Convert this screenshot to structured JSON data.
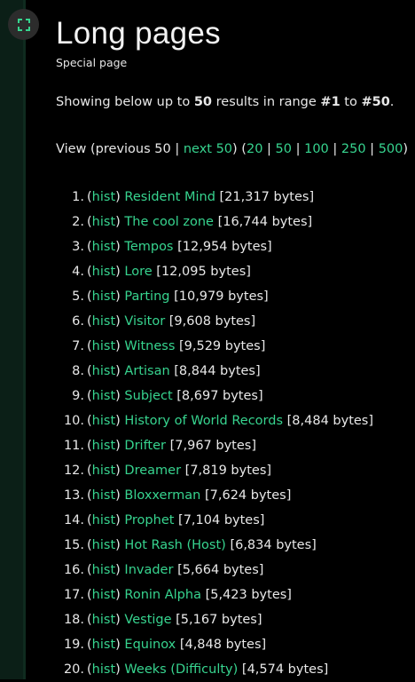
{
  "page": {
    "title": "Long pages",
    "subtitle": "Special page",
    "info": {
      "prefix": "Showing below up to ",
      "limit": "50",
      "middle": " results in range ",
      "from": "#1",
      "to_word": " to ",
      "to": "#50",
      "suffix": "."
    },
    "nav": {
      "view_label": "View (previous 50 | ",
      "next_label": "next 50",
      "after_next": ") (",
      "limits": [
        "20",
        "50",
        "100",
        "250",
        "500"
      ],
      "close": ")"
    }
  },
  "results": [
    {
      "num": "1.",
      "hist": "hist",
      "title": "Resident Mind",
      "size": "[21,317 bytes]"
    },
    {
      "num": "2.",
      "hist": "hist",
      "title": "The cool zone",
      "size": "[16,744 bytes]"
    },
    {
      "num": "3.",
      "hist": "hist",
      "title": "Tempos",
      "size": "[12,954 bytes]"
    },
    {
      "num": "4.",
      "hist": "hist",
      "title": "Lore",
      "size": "[12,095 bytes]"
    },
    {
      "num": "5.",
      "hist": "hist",
      "title": "Parting",
      "size": "[10,979 bytes]"
    },
    {
      "num": "6.",
      "hist": "hist",
      "title": "Visitor",
      "size": "[9,608 bytes]"
    },
    {
      "num": "7.",
      "hist": "hist",
      "title": "Witness",
      "size": "[9,529 bytes]"
    },
    {
      "num": "8.",
      "hist": "hist",
      "title": "Artisan",
      "size": "[8,844 bytes]"
    },
    {
      "num": "9.",
      "hist": "hist",
      "title": "Subject",
      "size": "[8,697 bytes]"
    },
    {
      "num": "10.",
      "hist": "hist",
      "title": "History of World Records",
      "size": "[8,484 bytes]"
    },
    {
      "num": "11.",
      "hist": "hist",
      "title": "Drifter",
      "size": "[7,967 bytes]"
    },
    {
      "num": "12.",
      "hist": "hist",
      "title": "Dreamer",
      "size": "[7,819 bytes]"
    },
    {
      "num": "13.",
      "hist": "hist",
      "title": "Bloxxerman",
      "size": "[7,624 bytes]"
    },
    {
      "num": "14.",
      "hist": "hist",
      "title": "Prophet",
      "size": "[7,104 bytes]"
    },
    {
      "num": "15.",
      "hist": "hist",
      "title": "Hot Rash (Host)",
      "size": "[6,834 bytes]"
    },
    {
      "num": "16.",
      "hist": "hist",
      "title": "Invader",
      "size": "[5,664 bytes]"
    },
    {
      "num": "17.",
      "hist": "hist",
      "title": "Ronin Alpha",
      "size": "[5,423 bytes]"
    },
    {
      "num": "18.",
      "hist": "hist",
      "title": "Vestige",
      "size": "[5,167 bytes]"
    },
    {
      "num": "19.",
      "hist": "hist",
      "title": "Equinox",
      "size": "[4,848 bytes]"
    },
    {
      "num": "20.",
      "hist": "hist",
      "title": "Weeks (Difficulty)",
      "size": "[4,574 bytes]"
    }
  ],
  "theme": {
    "background": "#000000",
    "link": "#37d48f",
    "text": "#e8e8e8",
    "rail": "#0b1f17"
  },
  "icons": {
    "expand": "expand-icon"
  }
}
